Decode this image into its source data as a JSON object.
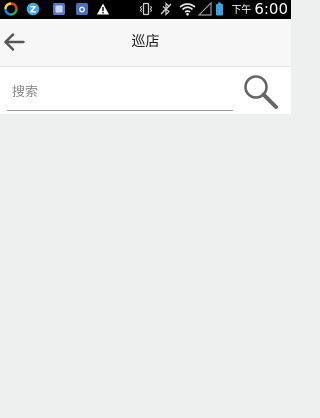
{
  "status_bar": {
    "ampm": "下午",
    "time": "6:00",
    "icons": [
      "sync-icon",
      "zalo-icon",
      "notification-app-icon",
      "camera-app-icon",
      "warning-icon",
      "vibrate-icon",
      "bluetooth-off-icon",
      "wifi-icon",
      "signal-icon",
      "battery-icon"
    ]
  },
  "header": {
    "title": "巡店",
    "back_icon": "arrow-left-icon"
  },
  "search": {
    "placeholder": "搜索",
    "value": "",
    "icon": "magnifier-icon"
  },
  "colors": {
    "status_bar_bg": "#000000",
    "header_bg": "#f7f7f7",
    "search_bg": "#ffffff",
    "content_bg": "#eef0f0",
    "title_text": "#1a1a1a",
    "placeholder_text": "#8a8a8a"
  }
}
